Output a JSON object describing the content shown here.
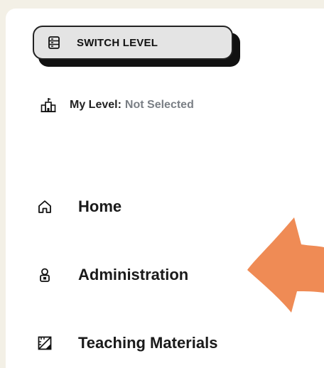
{
  "sidebar": {
    "switch_level": {
      "label": "SWITCH LEVEL",
      "icon": "database-icon"
    },
    "my_level": {
      "label": "My Level:",
      "value": "Not Selected",
      "icon": "school-building-icon"
    },
    "nav_items": [
      {
        "label": "Home",
        "icon": "home-icon"
      },
      {
        "label": "Administration",
        "icon": "admin-user-icon"
      },
      {
        "label": "Teaching Materials",
        "icon": "drafting-ruler-icon"
      }
    ]
  },
  "colors": {
    "page_bg": "#f3f0e6",
    "panel_bg": "#ffffff",
    "button_bg": "#e4e4e4",
    "muted_text": "#7a7f85",
    "arrow": "#ef8b55"
  }
}
